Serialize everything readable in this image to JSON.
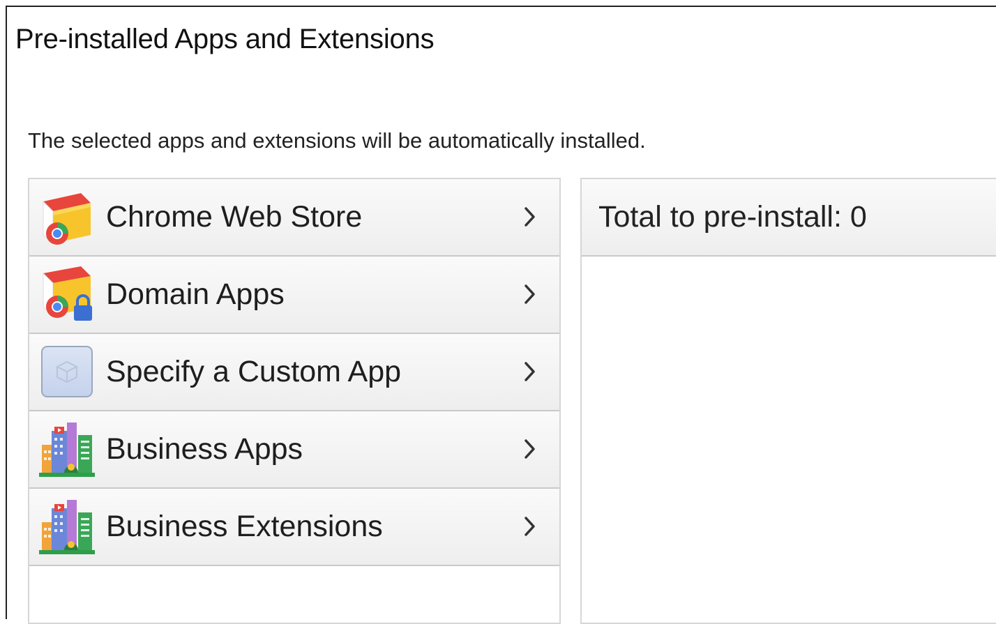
{
  "page": {
    "title": "Pre-installed Apps and Extensions",
    "description": "The selected apps and extensions will be automatically installed."
  },
  "sources": {
    "items": [
      {
        "label": "Chrome Web Store",
        "icon": "chrome-web-store-icon"
      },
      {
        "label": "Domain Apps",
        "icon": "domain-apps-icon"
      },
      {
        "label": "Specify a Custom App",
        "icon": "custom-app-icon"
      },
      {
        "label": "Business Apps",
        "icon": "business-apps-icon"
      },
      {
        "label": "Business Extensions",
        "icon": "business-extensions-icon"
      }
    ]
  },
  "summary": {
    "total_label": "Total to pre-install: 0"
  },
  "colors": {
    "border": "#d6d6d6",
    "divider": "#c9c9c9",
    "row_top": "#fafafa",
    "row_bottom": "#eeeeee"
  }
}
